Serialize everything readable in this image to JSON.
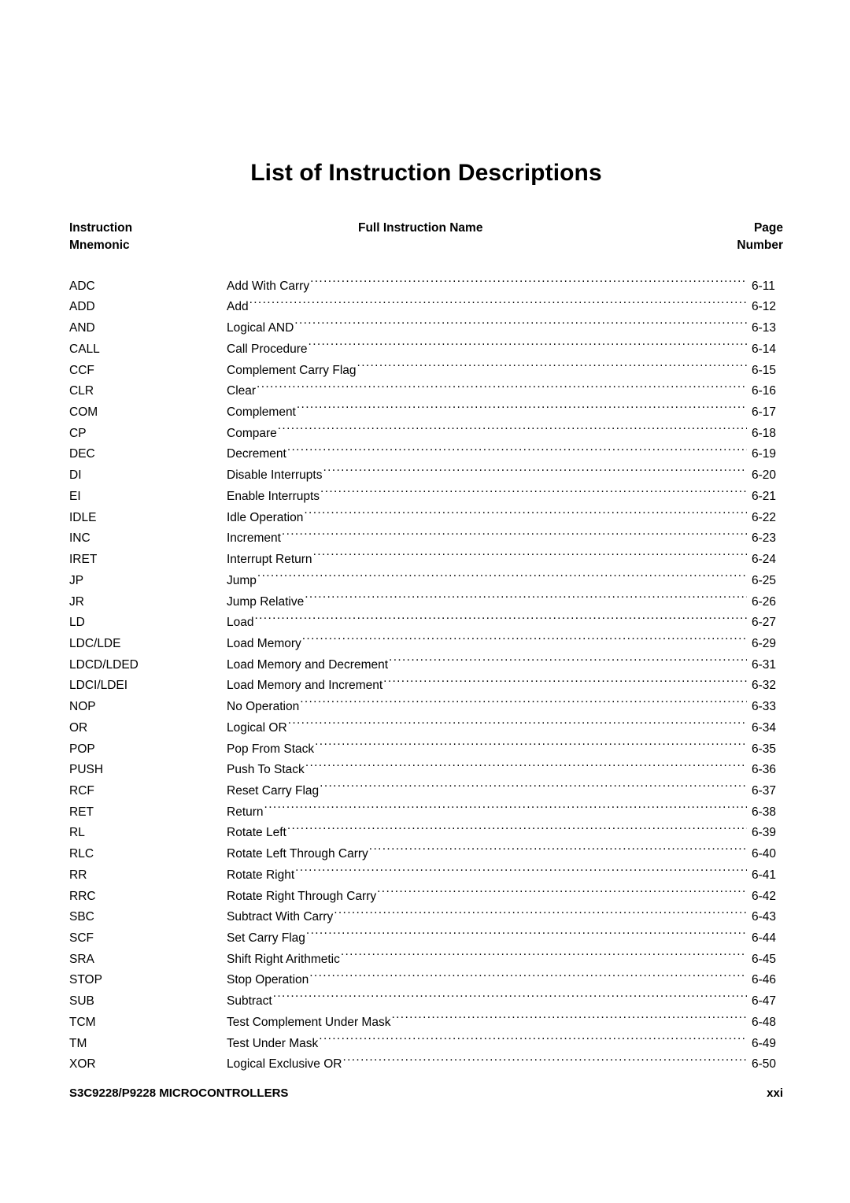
{
  "document": {
    "title": "List of Instruction Descriptions"
  },
  "table": {
    "headers": {
      "mnemonic_line1": "Instruction",
      "mnemonic_line2": "Mnemonic",
      "name": "Full Instruction Name",
      "page_line1": "Page",
      "page_line2": "Number"
    },
    "rows": [
      {
        "mnemonic": "ADC",
        "name": "Add With Carry",
        "page": "6-11"
      },
      {
        "mnemonic": "ADD",
        "name": "Add",
        "page": "6-12"
      },
      {
        "mnemonic": "AND",
        "name": "Logical AND",
        "page": "6-13"
      },
      {
        "mnemonic": "CALL",
        "name": "Call Procedure",
        "page": "6-14"
      },
      {
        "mnemonic": "CCF",
        "name": "Complement Carry Flag",
        "page": "6-15"
      },
      {
        "mnemonic": "CLR",
        "name": "Clear",
        "page": "6-16"
      },
      {
        "mnemonic": "COM",
        "name": "Complement",
        "page": "6-17"
      },
      {
        "mnemonic": "CP",
        "name": "Compare",
        "page": "6-18"
      },
      {
        "mnemonic": "DEC",
        "name": "Decrement",
        "page": "6-19"
      },
      {
        "mnemonic": "DI",
        "name": "Disable Interrupts",
        "page": "6-20"
      },
      {
        "mnemonic": "EI",
        "name": "Enable Interrupts",
        "page": "6-21"
      },
      {
        "mnemonic": "IDLE",
        "name": "Idle Operation",
        "page": "6-22"
      },
      {
        "mnemonic": "INC",
        "name": "Increment",
        "page": "6-23"
      },
      {
        "mnemonic": "IRET",
        "name": "Interrupt Return",
        "page": "6-24"
      },
      {
        "mnemonic": "JP",
        "name": "Jump",
        "page": "6-25"
      },
      {
        "mnemonic": "JR",
        "name": "Jump Relative",
        "page": "6-26"
      },
      {
        "mnemonic": "LD",
        "name": "Load",
        "page": "6-27"
      },
      {
        "mnemonic": "LDC/LDE",
        "name": "Load Memory",
        "page": "6-29"
      },
      {
        "mnemonic": "LDCD/LDED",
        "name": "Load Memory and Decrement",
        "page": "6-31"
      },
      {
        "mnemonic": "LDCI/LDEI",
        "name": "Load Memory and Increment",
        "page": "6-32"
      },
      {
        "mnemonic": "NOP",
        "name": "No Operation",
        "page": "6-33"
      },
      {
        "mnemonic": "OR",
        "name": "Logical OR",
        "page": "6-34"
      },
      {
        "mnemonic": "POP",
        "name": "Pop From Stack",
        "page": "6-35"
      },
      {
        "mnemonic": "PUSH",
        "name": "Push To Stack",
        "page": "6-36"
      },
      {
        "mnemonic": "RCF",
        "name": "Reset Carry Flag",
        "page": "6-37"
      },
      {
        "mnemonic": "RET",
        "name": "Return",
        "page": "6-38"
      },
      {
        "mnemonic": "RL",
        "name": "Rotate Left",
        "page": "6-39"
      },
      {
        "mnemonic": "RLC",
        "name": "Rotate Left Through Carry",
        "page": "6-40"
      },
      {
        "mnemonic": "RR",
        "name": "Rotate Right",
        "page": "6-41"
      },
      {
        "mnemonic": "RRC",
        "name": "Rotate Right Through Carry",
        "page": "6-42"
      },
      {
        "mnemonic": "SBC",
        "name": "Subtract With Carry",
        "page": "6-43"
      },
      {
        "mnemonic": "SCF",
        "name": "Set Carry Flag",
        "page": "6-44"
      },
      {
        "mnemonic": "SRA",
        "name": "Shift Right Arithmetic",
        "page": "6-45"
      },
      {
        "mnemonic": "STOP",
        "name": "Stop Operation",
        "page": "6-46"
      },
      {
        "mnemonic": "SUB",
        "name": "Subtract",
        "page": "6-47"
      },
      {
        "mnemonic": "TCM",
        "name": "Test Complement Under Mask",
        "page": "6-48"
      },
      {
        "mnemonic": "TM",
        "name": "Test Under Mask",
        "page": "6-49"
      },
      {
        "mnemonic": "XOR",
        "name": "Logical Exclusive OR",
        "page": "6-50"
      }
    ]
  },
  "footer": {
    "left": "S3C9228/P9228 MICROCONTROLLERS",
    "right": "xxi"
  }
}
